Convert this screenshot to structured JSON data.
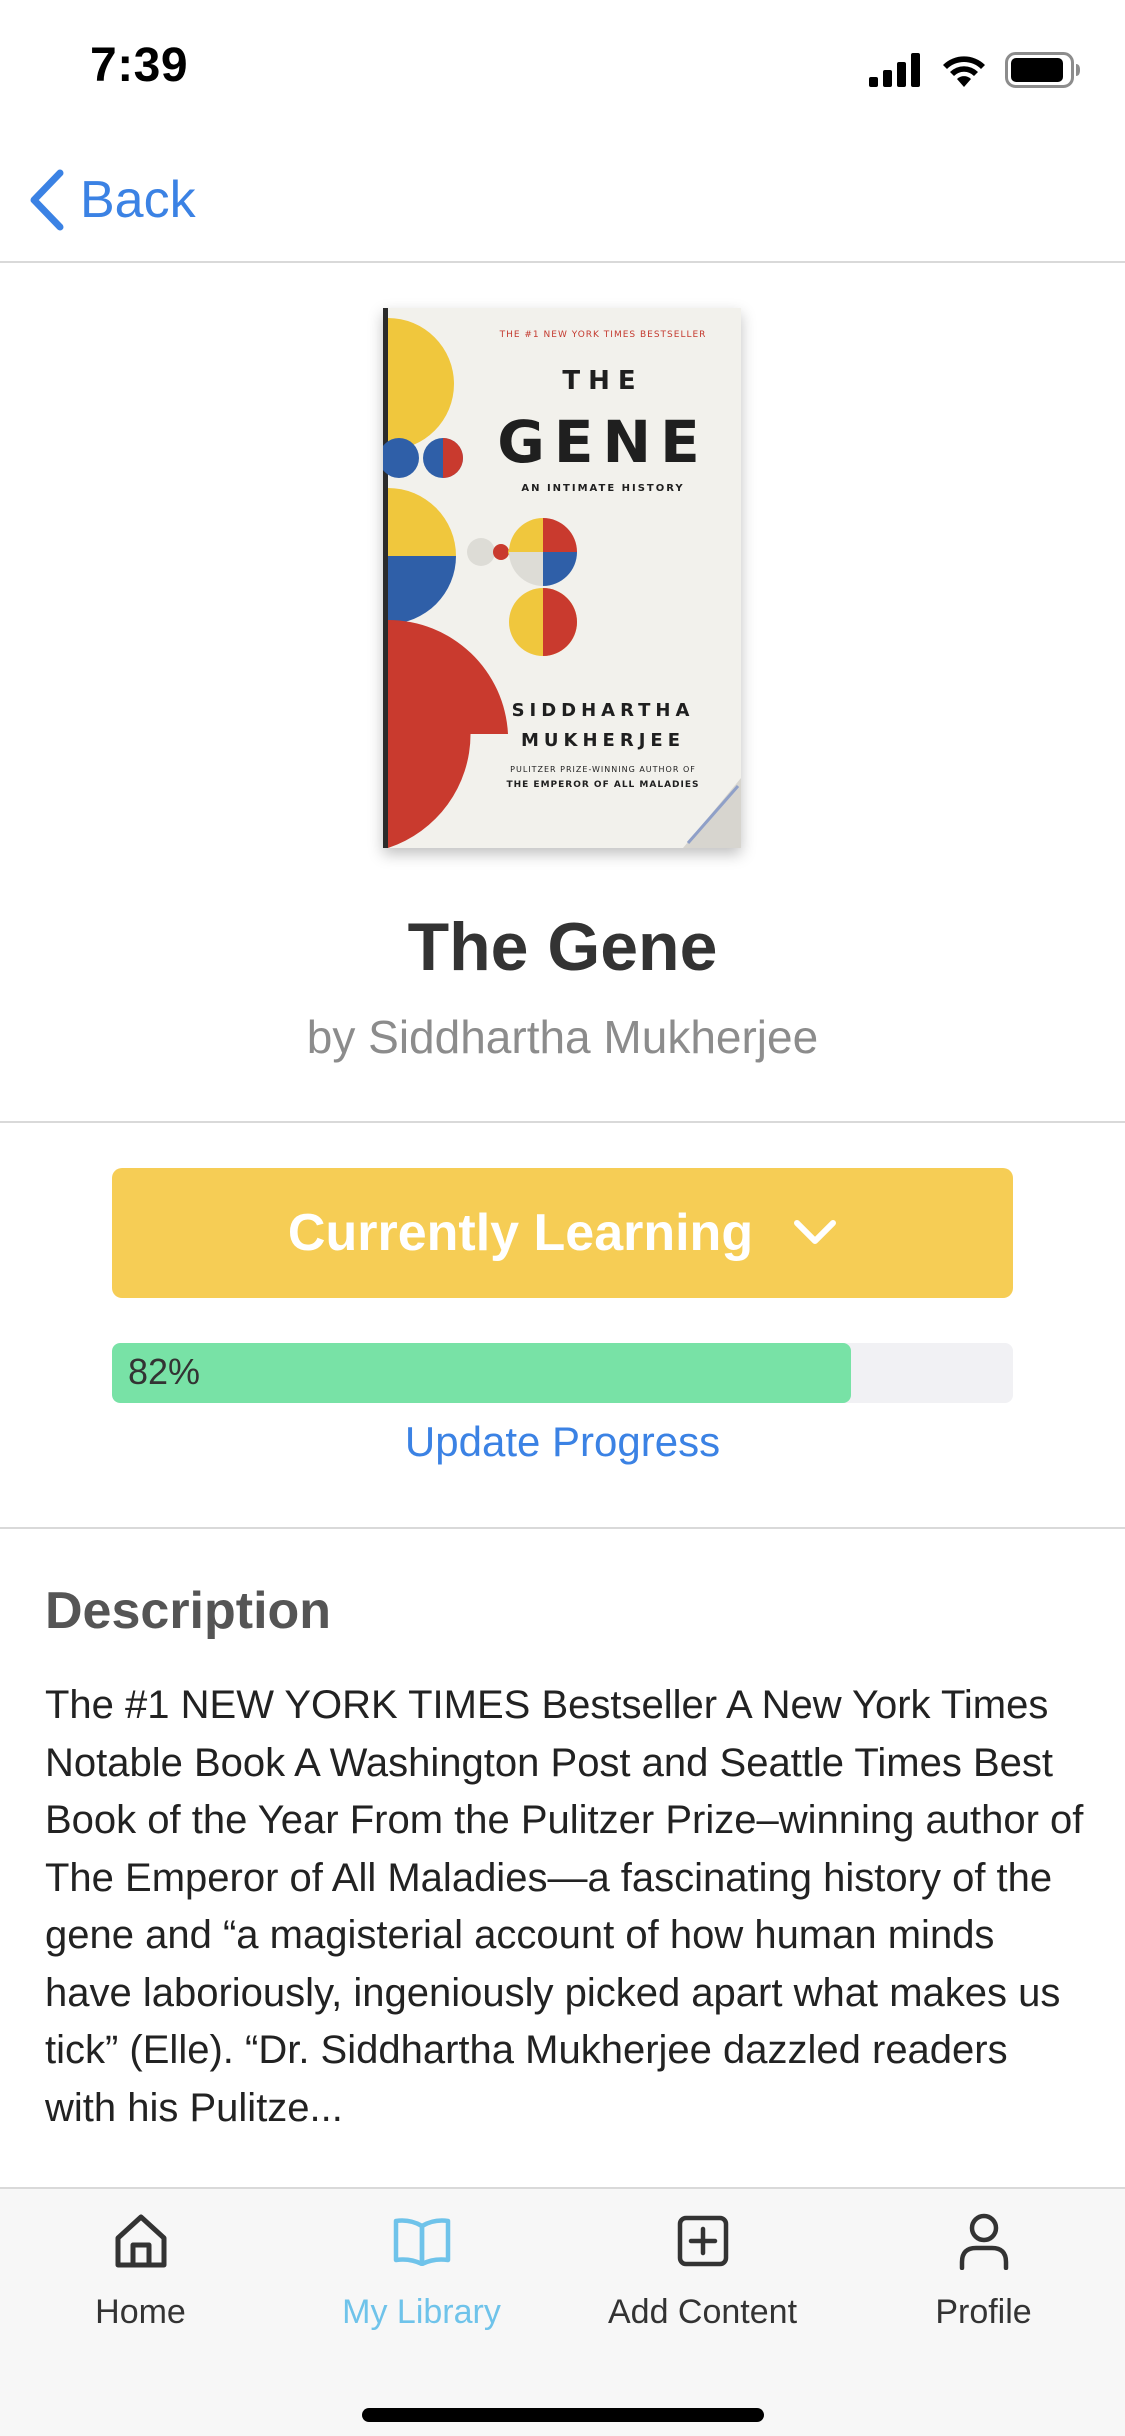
{
  "status_bar": {
    "time": "7:39",
    "icons": [
      "cellular-signal-icon",
      "wifi-icon",
      "battery-icon"
    ]
  },
  "nav": {
    "back_label": "Back",
    "back_icon": "chevron-left-icon"
  },
  "book": {
    "title": "The Gene",
    "author": "by Siddhartha Mukherjee",
    "cover": {
      "tag": "THE #1 NEW YORK TIMES BESTSELLER",
      "the": "THE",
      "title": "GENE",
      "subtitle": "AN INTIMATE HISTORY",
      "author_first": "SIDDHARTHA",
      "author_last": "MUKHERJEE",
      "blurb_1": "PULITZER PRIZE-WINNING AUTHOR OF",
      "blurb_2": "THE EMPEROR OF ALL MALADIES"
    }
  },
  "learning_status": {
    "label": "Currently Learning",
    "icon": "chevron-down-icon",
    "progress_percent": 82,
    "progress_label": "82%",
    "update_label": "Update Progress"
  },
  "description": {
    "heading": "Description",
    "body": "The #1 NEW YORK TIMES Bestseller A New York Times Notable Book A Washington Post and Seattle Times Best Book of the Year From the Pulitzer Prize–winning author of The Emperor of All Maladies—a fascinating history of the gene and “a magisterial account of how human minds have laboriously, ingeniously picked apart what makes us tick” (Elle). “Dr. Siddhartha Mukherjee dazzled readers with his Pulitze..."
  },
  "tabs": [
    {
      "label": "Home",
      "icon": "home-icon",
      "active": false
    },
    {
      "label": "My Library",
      "icon": "book-icon",
      "active": true
    },
    {
      "label": "Add Content",
      "icon": "add-square-icon",
      "active": false
    },
    {
      "label": "Profile",
      "icon": "person-icon",
      "active": false
    }
  ],
  "colors": {
    "accent_blue": "#3b82e4",
    "status_yellow": "#f6cd55",
    "progress_green": "#78e2a6",
    "tab_active": "#6fc3ea"
  }
}
